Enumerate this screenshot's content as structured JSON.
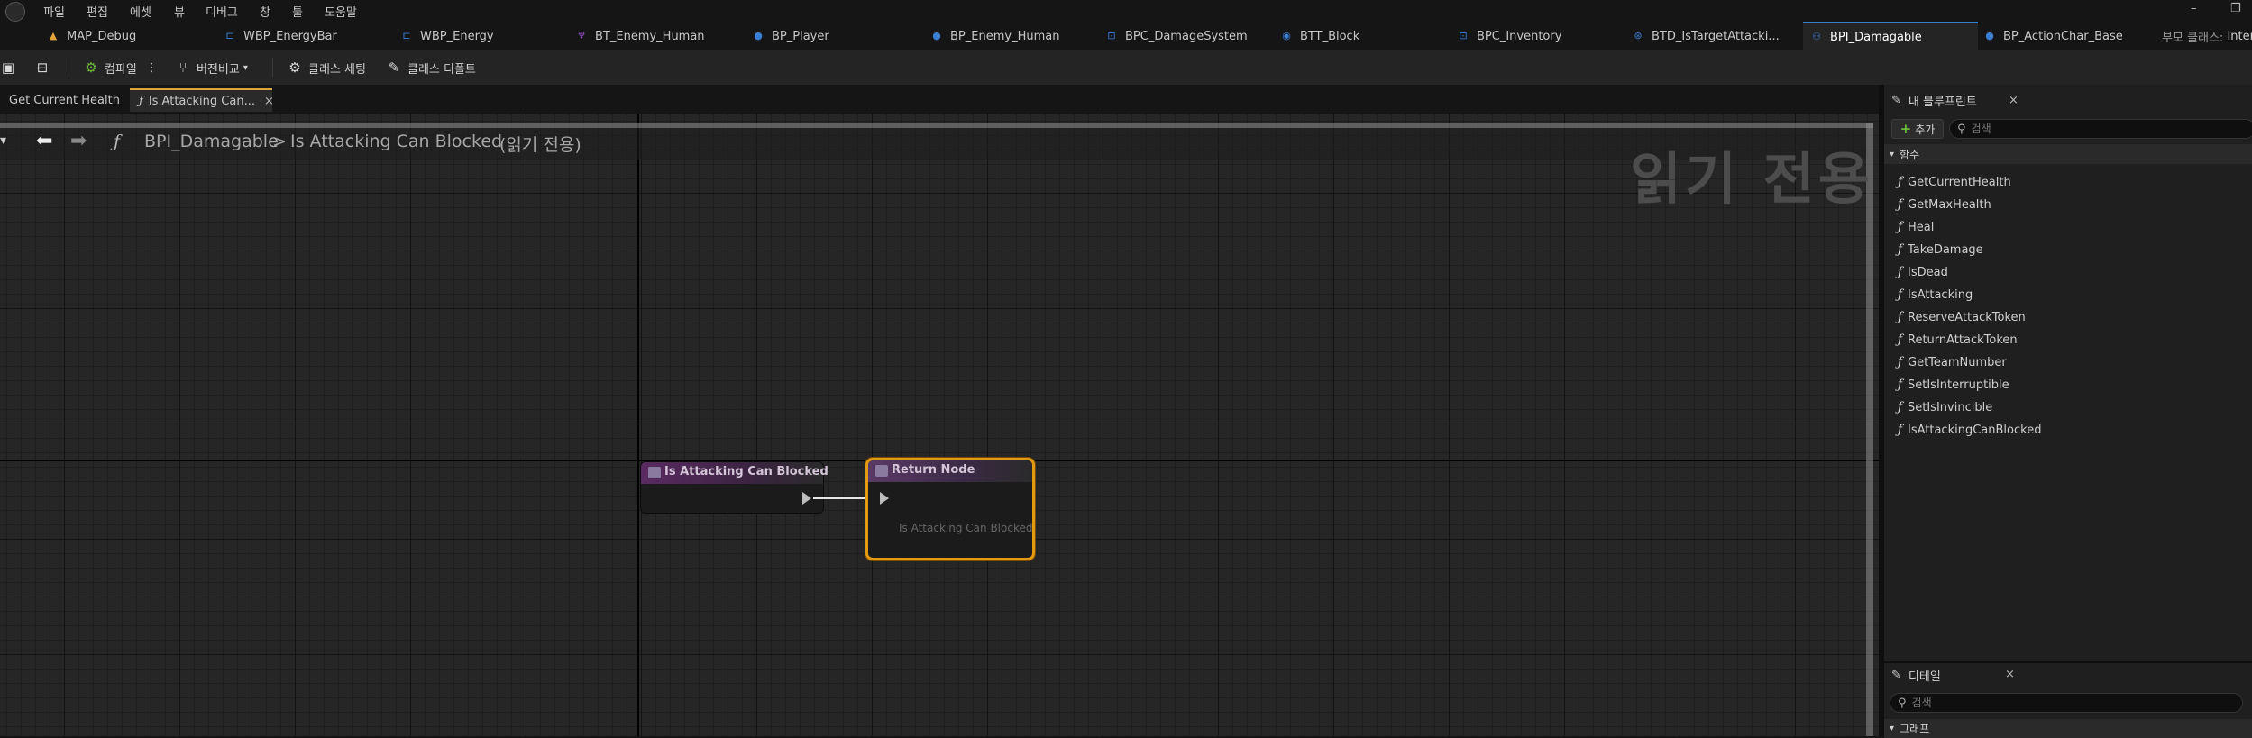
{
  "menubar": {
    "items": [
      "파일",
      "편집",
      "에셋",
      "뷰",
      "디버그",
      "창",
      "툴",
      "도움말"
    ],
    "window_controls": [
      "–",
      "❐"
    ]
  },
  "asset_tabs": [
    {
      "label": "MAP_Debug",
      "icon": "level-icon",
      "color": "#e0a43a"
    },
    {
      "label": "WBP_EnergyBar",
      "icon": "widget-blueprint-icon",
      "color": "#3b7ed6"
    },
    {
      "label": "WBP_Energy",
      "icon": "widget-blueprint-icon",
      "color": "#3b7ed6"
    },
    {
      "label": "BT_Enemy_Human",
      "icon": "behavior-tree-icon",
      "color": "#9a4fd0"
    },
    {
      "label": "BP_Player",
      "icon": "character-icon",
      "color": "#3b7ed6"
    },
    {
      "label": "BP_Enemy_Human",
      "icon": "character-icon",
      "color": "#3b7ed6"
    },
    {
      "label": "BPC_DamageSystem",
      "icon": "component-icon",
      "color": "#3b7ed6"
    },
    {
      "label": "BTT_Block",
      "icon": "task-icon",
      "color": "#3b7ed6"
    },
    {
      "label": "BPC_Inventory",
      "icon": "component-icon",
      "color": "#3b7ed6"
    },
    {
      "label": "BTD_IsTargetAttacki...",
      "icon": "decorator-icon",
      "color": "#3b7ed6"
    },
    {
      "label": "BPI_Damagable",
      "icon": "interface-icon",
      "color": "#3b7ed6",
      "active": true
    },
    {
      "label": "BP_ActionChar_Base",
      "icon": "character-icon",
      "color": "#3b7ed6"
    }
  ],
  "parent_class": {
    "label": "부모 클래스:",
    "value": "Inter"
  },
  "toolbar": {
    "compile": "컴파일",
    "diff": "버전비교",
    "class_settings": "클래스 세팅",
    "class_defaults": "클래스 디폴트"
  },
  "doc_tabs": {
    "first": "Get Current Health",
    "active": "Is Attacking Can...",
    "close": "×"
  },
  "breadcrumb": {
    "owner": "BPI_Damagable",
    "separator": ">",
    "function": "Is Attacking Can Blocked",
    "readonly_note": "(읽기 전용)"
  },
  "watermark": "읽기 전용",
  "nodes": {
    "entry": {
      "title": "Is Attacking Can Blocked"
    },
    "return": {
      "title": "Return Node",
      "output_label": "Is Attacking Can Blocked"
    }
  },
  "my_blueprint": {
    "title": "내 블루프린트",
    "close": "×",
    "add_label": "추가",
    "search_placeholder": "검색",
    "category": "함수",
    "functions": [
      "GetCurrentHealth",
      "GetMaxHealth",
      "Heal",
      "TakeDamage",
      "IsDead",
      "IsAttacking",
      "ReserveAttackToken",
      "ReturnAttackToken",
      "GetTeamNumber",
      "SetIsInterruptible",
      "SetIsInvincible",
      "IsAttackingCanBlocked"
    ]
  },
  "details": {
    "title": "디테일",
    "close": "×",
    "search_placeholder": "검색",
    "section": "그래프"
  }
}
